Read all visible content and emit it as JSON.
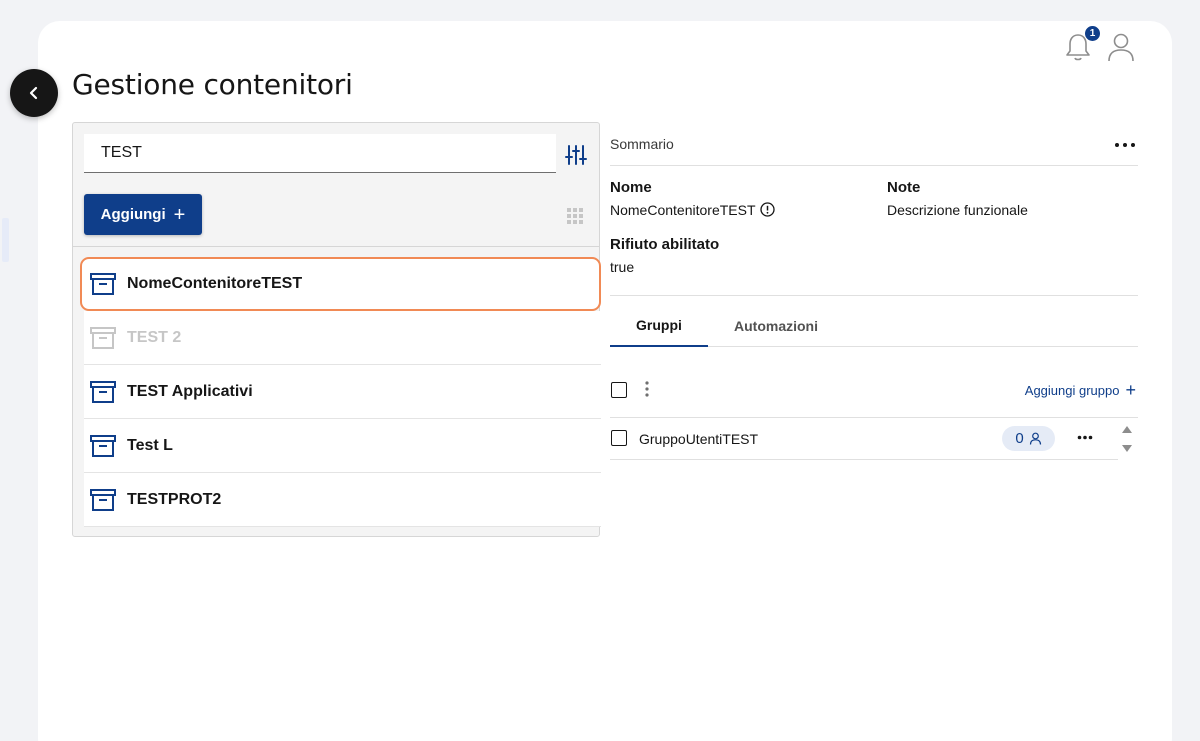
{
  "page": {
    "title": "Gestione contenitori"
  },
  "header": {
    "notification_count": "1"
  },
  "search": {
    "value": "TEST",
    "placeholder": ""
  },
  "toolbar": {
    "add_label": "Aggiungi",
    "add_plus": "+"
  },
  "containers": [
    {
      "name": "NomeContenitoreTEST",
      "state": "selected"
    },
    {
      "name": "TEST 2",
      "state": "disabled"
    },
    {
      "name": "TEST Applicativi",
      "state": "normal"
    },
    {
      "name": "Test L",
      "state": "normal"
    },
    {
      "name": "TESTPROT2",
      "state": "normal"
    }
  ],
  "summary": {
    "section_label": "Sommario",
    "name_label": "Nome",
    "name_value": "NomeContenitoreTEST",
    "note_label": "Note",
    "note_value": "Descrizione funzionale",
    "waste_label": "Rifiuto abilitato",
    "waste_value": "true"
  },
  "tabs": [
    {
      "label": "Gruppi",
      "active": true
    },
    {
      "label": "Automazioni",
      "active": false
    }
  ],
  "groups": {
    "add_label": "Aggiungi gruppo",
    "add_plus": "+",
    "rows": [
      {
        "name": "GruppoUtentiTEST",
        "count": "0"
      }
    ]
  },
  "colors": {
    "accent": "#0f3e8a",
    "highlight": "#f18a55",
    "disabled": "#c6c6c6"
  }
}
